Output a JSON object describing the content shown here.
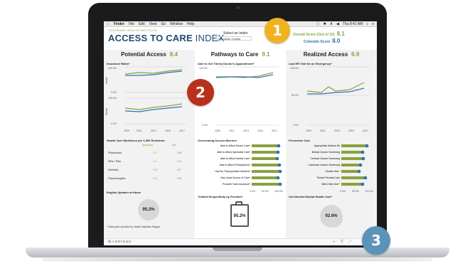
{
  "menubar": {
    "apple": "",
    "items": [
      "Finder",
      "File",
      "Edit",
      "View",
      "Go",
      "Window",
      "Help"
    ],
    "right": [
      "ⓘ",
      "✱",
      "⬆",
      "◀",
      "Thu 8:41 AM",
      "⌕",
      "≡"
    ]
  },
  "header": {
    "org": "COLORADO HEALTH INSTITUTE",
    "brand_bold": "ACCESS TO CARE",
    "brand_light": " INDEX",
    "select_title": "Select an Index",
    "select_value": "Arapahoe County",
    "overall_label": "Overall Score (Out of 10)",
    "overall_value": "8.1",
    "co_label": "Colorado Score",
    "co_value": "8.0"
  },
  "colors": {
    "green": "#8aa13d",
    "blue": "#2a72b5",
    "navy": "#1e4a6e",
    "gray_panel": "#f2f2f2"
  },
  "potential": {
    "title": "Potential Access",
    "score": "8.4",
    "insurance_title": "Insurance Rates*",
    "health_label": "Health",
    "dental_label": "Dental",
    "ticks_top": [
      "100.0%",
      "0.0%"
    ],
    "ticks_bottom": [
      "100.0%",
      "0.0%"
    ],
    "years": [
      "2009",
      "2011",
      "2013",
      "2015",
      "2017"
    ],
    "workforce_title": "Health Care Workforce per 1,000 Residents",
    "workforce_cols": [
      "Arapahoe",
      "CO"
    ],
    "workforce_rows": [
      {
        "name": "Physicians",
        "a": "3.2",
        "c": "2.8"
      },
      {
        "name": "NPs / PAs",
        "a": "1.1",
        "c": "1.2"
      },
      {
        "name": "Dentists",
        "a": "0.8",
        "c": "0.7"
      },
      {
        "name": "Psychologists",
        "a": "0.5",
        "c": "0.5"
      }
    ],
    "english_title": "English Speaker at Home",
    "english_value": "95.2%",
    "note": "* Data point reported by Health Statistics Region"
  },
  "pathways": {
    "title": "Pathways to Care",
    "score": "9.1",
    "timely_title": "Able to Get Timely Doctor's Appointment*",
    "ticks": [
      "100.0%",
      "0.0%"
    ],
    "years": [
      "2009",
      "2011",
      "2013",
      "2015",
      "2017"
    ],
    "barriers_title": "Overcoming Access Barriers",
    "barriers": [
      "Able to Afford Doctor Care*",
      "Able to Afford Specialist Care*",
      "Able to Afford Dental Care*",
      "Able to Afford Prescriptions*",
      "Had No Transportation Barriers*",
      "Has Usual Source of Care*",
      "Provider Took Insurance*"
    ],
    "bar_ticks": [
      "0.0%",
      "50.0%",
      "100.0%"
    ],
    "respect_title": "Treated Respectfully by Provider*",
    "respect_value": "95.2%"
  },
  "realized": {
    "title": "Realized Access",
    "score": "6.9",
    "er_title": "Last ER Visit for an Emergency*",
    "ticks": [
      "100.0%",
      "50.0%",
      "0.0%"
    ],
    "years": [
      "2009",
      "2011",
      "2013",
      "2015",
      "2017"
    ],
    "preventive_title": "Preventive Care",
    "preventive": [
      "Appropriate Asthma Rx",
      "Breast Cancer Screening",
      "Cervical Cancer Screening",
      "Colorectal Cancer Screening",
      "Dental Visit *",
      "Timely Prenatal Care",
      "Well-Child Visit *"
    ],
    "bar_ticks": [
      "0.0%",
      "50.0%",
      "100.0%"
    ],
    "mental_title": "Got Needed Mental Health Care*",
    "mental_value": "92.6%"
  },
  "footer": {
    "tab": "⊞ + a b l e a u",
    "controls": [
      "←",
      "→",
      "⇤",
      "⎘",
      "⤢"
    ]
  },
  "markers": [
    "1",
    "2",
    "3"
  ]
}
